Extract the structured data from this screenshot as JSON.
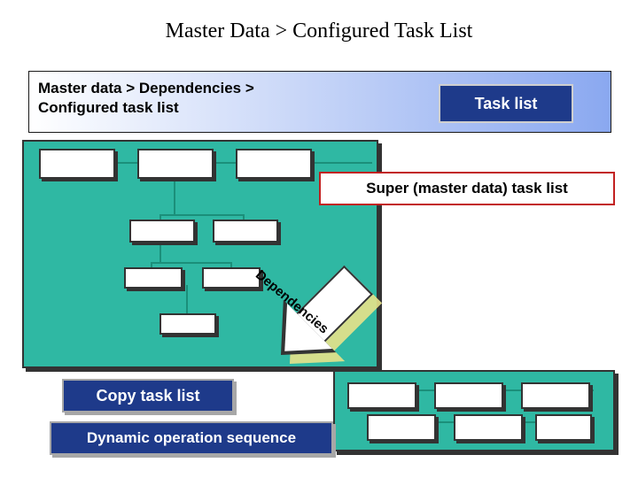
{
  "title": "Master Data > Configured Task List",
  "breadcrumb": "Master data > Dependencies > Configured task list",
  "badges": {
    "task_list": "Task list",
    "copy": "Copy task list",
    "dynamic": "Dynamic operation sequence"
  },
  "labels": {
    "super_region": "Super (master data) task list",
    "arrow": "Dependencies"
  },
  "colors": {
    "teal": "#2fb8a3",
    "navy": "#1e3a8a",
    "highlight_border": "#c22020"
  }
}
